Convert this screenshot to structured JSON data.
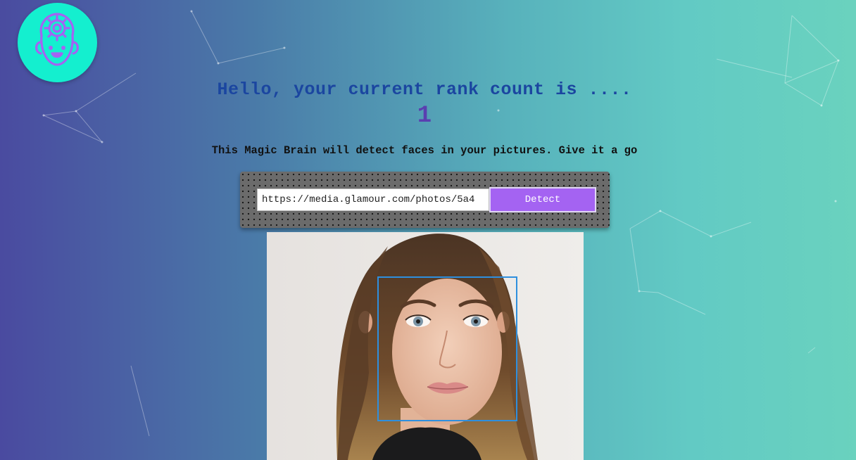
{
  "app": {
    "logo_icon": "brain-gear-head-icon"
  },
  "header": {
    "rank_message": "Hello, your current rank count is ....",
    "rank_count": "1"
  },
  "intro": {
    "text": "This Magic Brain will detect faces in your pictures. Give it a go"
  },
  "form": {
    "url_value": "https://media.glamour.com/photos/5a4",
    "detect_label": "Detect"
  },
  "result": {
    "faces_detected": 1
  },
  "colors": {
    "logo_bg": "#14efcf",
    "title_text": "#1b46a0",
    "rank_count": "#5a3fb0",
    "detect_button": "#a463f2",
    "face_box": "#2e8fde"
  }
}
